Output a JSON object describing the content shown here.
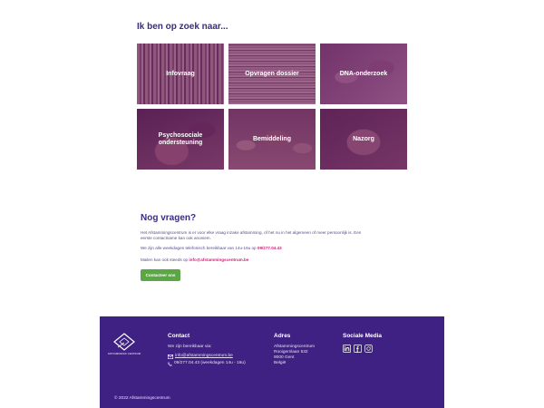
{
  "section": {
    "title": "Ik ben op zoek naar..."
  },
  "tiles": [
    {
      "label": "Infovraag"
    },
    {
      "label": "Opvragen dossier"
    },
    {
      "label": "DNA-onderzoek"
    },
    {
      "label": "Psychosociale ondersteuning"
    },
    {
      "label": "Bemiddeling"
    },
    {
      "label": "Nazorg"
    }
  ],
  "questions": {
    "title": "Nog vragen?",
    "intro": "Het Afstammingscentrum is er voor elke vraag inzake afstamming, of het nu in het algemeen of meer persoonlijk is. Een eerste contactname kan ook anoniem.",
    "phone_text": "We zijn alle weekdagen telefonisch bereikbaar van 14u-16u op ",
    "phone": "09/277.04.43",
    "mail_text": "Mailen kan ook steeds op ",
    "email": "info@afstammingscentrum.be",
    "button": "Contacteer ons"
  },
  "footer": {
    "logo_text": "AFSTAMMINGS CENTRUM",
    "contact_title": "Contact",
    "contact_reach": "We zijn bereikbaar via:",
    "contact_email": "info@afstammingscentrum.be",
    "contact_phone": "09/277.04.43 (weekdagen 14u - 16u)",
    "address_title": "Adres",
    "address_lines": [
      "Afstammingscentrum",
      "Rooigemlaan 532",
      "9000 Gent",
      "België"
    ],
    "social_title": "Sociale Media",
    "copyright": "© 2022 Afstammingscentrum"
  },
  "colors": {
    "accent_purple": "#3f2184",
    "heading_purple": "#3a2b82",
    "link_pink": "#d6217a",
    "button_green": "#5aa843"
  }
}
